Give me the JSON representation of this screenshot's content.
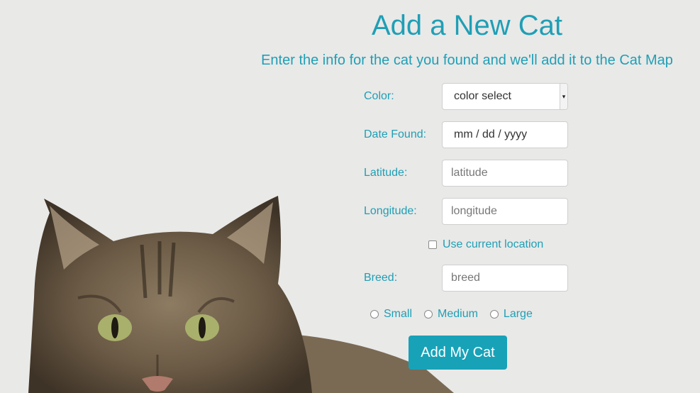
{
  "header": {
    "title": "Add a New Cat",
    "subtitle": "Enter the info for the cat you found and we'll add it to the Cat Map"
  },
  "form": {
    "color": {
      "label": "Color:",
      "value": "color select"
    },
    "date": {
      "label": "Date Found:",
      "value": "mm / dd / yyyy"
    },
    "latitude": {
      "label": "Latitude:",
      "placeholder": "latitude"
    },
    "longitude": {
      "label": "Longitude:",
      "placeholder": "longitude"
    },
    "use_location": {
      "label": "Use current location",
      "checked": false
    },
    "breed": {
      "label": "Breed:",
      "placeholder": "breed"
    },
    "sizes": [
      "Small",
      "Medium",
      "Large"
    ],
    "submit_label": "Add My Cat"
  },
  "colors": {
    "accent": "#1f9fb5",
    "button": "#17a2b8",
    "background": "#e9e9e8"
  }
}
